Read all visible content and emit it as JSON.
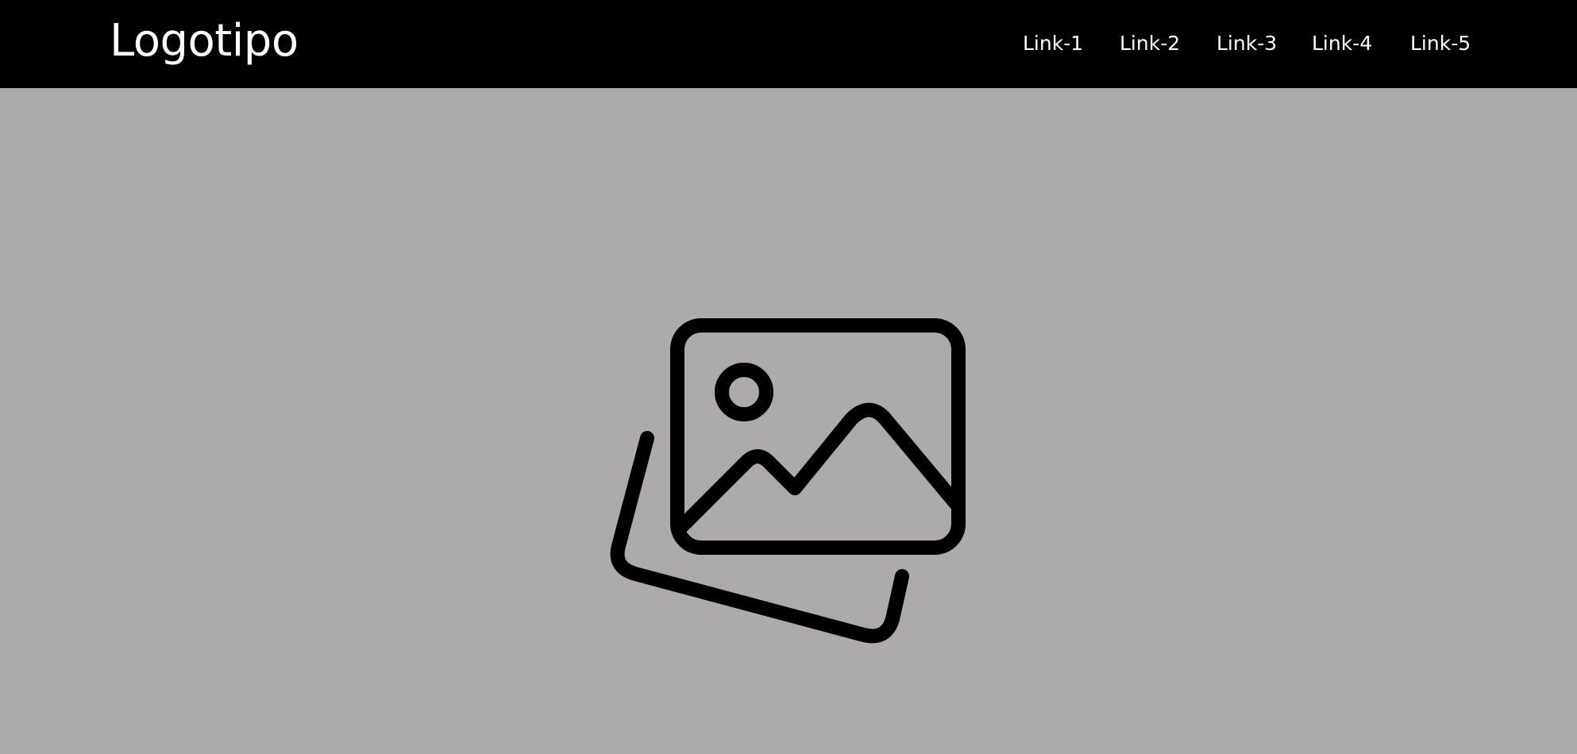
{
  "header": {
    "logo_text": "Logotipo",
    "background_color": "#000000",
    "text_color": "#ffffff"
  },
  "nav": {
    "links": [
      {
        "label": "Link-1"
      },
      {
        "label": "Link-2"
      },
      {
        "label": "Link-3"
      },
      {
        "label": "Link-4"
      },
      {
        "label": "Link-5"
      }
    ]
  },
  "hero": {
    "background_color": "#aeaaa9",
    "icon": "image-placeholder-icon"
  }
}
